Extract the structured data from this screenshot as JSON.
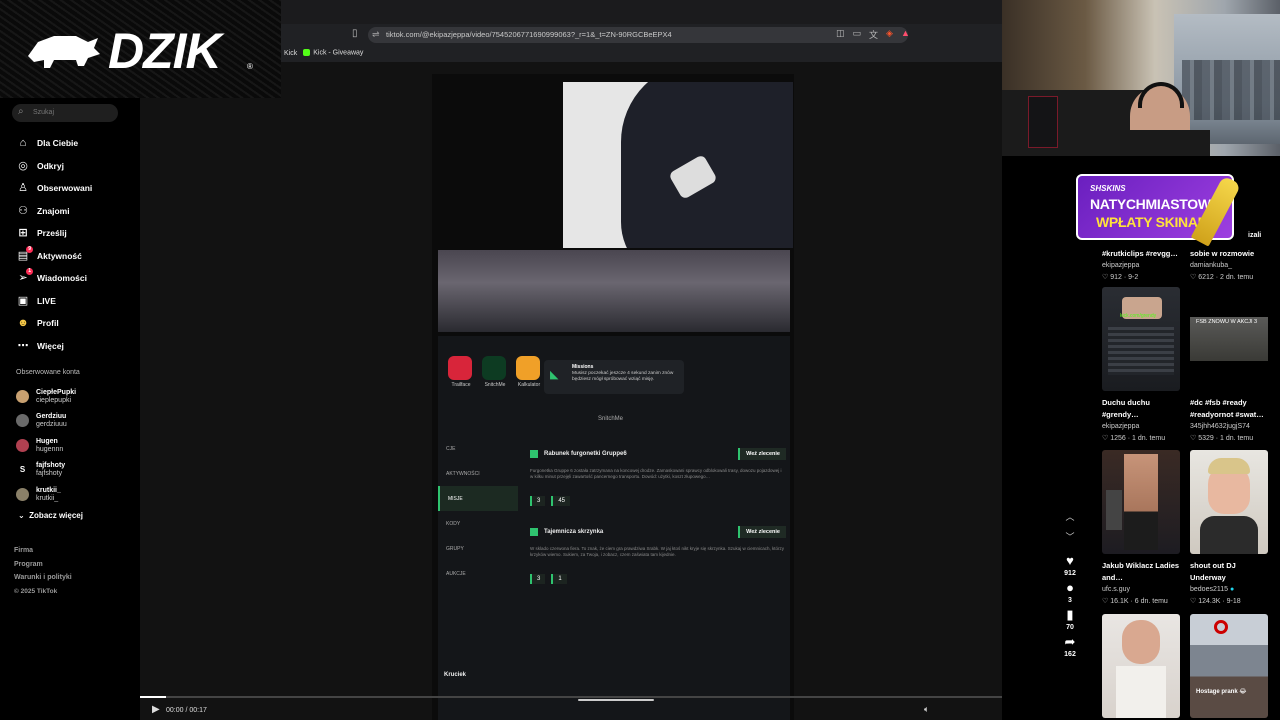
{
  "browser": {
    "url": "tiktok.com/@ekipazjeppa/video/7545206771690999063?_r=1&_t=ZN-90RGCBeEPX4",
    "bookmarks": [
      "Kick",
      "Kick - Giveaway"
    ]
  },
  "logo": {
    "text": "DZIK",
    "reg": "®"
  },
  "sidebar": {
    "search_placeholder": "Szukaj",
    "nav": [
      {
        "label": "Dla Ciebie",
        "icon": "home-icon"
      },
      {
        "label": "Odkryj",
        "icon": "compass-icon"
      },
      {
        "label": "Obserwowani",
        "icon": "following-icon"
      },
      {
        "label": "Znajomi",
        "icon": "friends-icon"
      },
      {
        "label": "Prześlij",
        "icon": "upload-icon"
      },
      {
        "label": "Aktywność",
        "icon": "activity-icon",
        "badge": "9"
      },
      {
        "label": "Wiadomości",
        "icon": "messages-icon",
        "badge": "1"
      },
      {
        "label": "LIVE",
        "icon": "live-icon"
      },
      {
        "label": "Profil",
        "icon": "profile-icon"
      },
      {
        "label": "Więcej",
        "icon": "more-icon"
      }
    ],
    "followed_title": "Obserwowane konta",
    "accounts": [
      {
        "name": "CiepłePupki",
        "handle": "cieplepupki"
      },
      {
        "name": "Gerdziuu",
        "handle": "gerdziuuu"
      },
      {
        "name": "Hugen",
        "handle": "hugennn"
      },
      {
        "name": "fajfshoty",
        "handle": "fajfshoty",
        "initial": "S"
      },
      {
        "name": "krutkii_",
        "handle": "krutkii_"
      }
    ],
    "see_more": "Zobacz więcej",
    "footer": [
      "Firma",
      "Program",
      "Warunki i polityki",
      "© 2025 TikTok"
    ]
  },
  "video": {
    "time": "00:00 / 00:17",
    "progress": 0.03,
    "phone": {
      "apps": [
        "Trailface",
        "SnitchMe",
        "Kalkulator"
      ],
      "toast_title": "Missions",
      "toast_body": "Musisz poczekać jeszcze 4 sekund zanim znów będziesz mógł spróbować wziąć misję.",
      "app_title": "SnitchMe",
      "menu": [
        "CJE",
        "AKTYWNOŚCI",
        "MISJE",
        "KODY",
        "GRUPY",
        "AUKCJE"
      ],
      "missions": [
        {
          "title": "Rabunek furgonetki Gruppe6",
          "button": "Weź zlecenie",
          "desc": "Furgonetka Gruppe 6 została zatrzymana na koncowej drodze. Zamaskowani sprawcy odblokowali trasy, dowozu pojazdowej i w kilku minut przejęli zawartość pancernego transportu. Dowód: użytki, koszt złupowego…",
          "stat1": "3",
          "stat2": "45"
        },
        {
          "title": "Tajemnicza skrzynka",
          "button": "Weź zlecenie",
          "desc": "W sklado czerwona fiera. To znak, że ciem gra prawdziwa Srabk. W jaj ktoś nikt kryje się skrzynka. Szukaj w ciemnicach, którzy krzyków wiemo. Sukiem, za Twoja, i zobacz, czem zaświata tam kijednie.",
          "stat1": "3",
          "stat2": "1"
        }
      ],
      "footer_label": "Kruciek"
    }
  },
  "actions": {
    "likes": "912",
    "comments": "3",
    "saves": "70",
    "shares": "162"
  },
  "ad": {
    "brand": "SHSKINS",
    "line1": "NATYCHMIASTOWE",
    "line2": "WPŁATY SKINAMI!"
  },
  "above_label": "izali",
  "grid": [
    {
      "title": "#krutkiclips #revgg…",
      "author": "ekipazjeppa",
      "stats": "♡ 912 · 9-2"
    },
    {
      "title": "sobie w rozmowie",
      "author": "damiankuba_",
      "stats": "♡ 6212 · 2 dn. temu"
    },
    {
      "title": "Duchu duchu #grendy…",
      "author": "ekipazjeppa",
      "stats": "♡ 1256 · 1 dn. temu",
      "thumb_text": "kick.com/grendy"
    },
    {
      "title": "#dc #fsb #ready #readyornot #swat…",
      "author": "345jhh4632jugjS74",
      "stats": "♡ 5329 · 1 dn. temu",
      "thumb_text": "FSB ZNOWU W AKCJI 3"
    },
    {
      "title": "Jakub Wiklacz Ladies and…",
      "author": "ufc.s.guy",
      "stats": "♡ 16.1K · 6 dn. temu"
    },
    {
      "title": "shout out DJ Underway",
      "author": "bedoes2115",
      "stats": "♡ 124.3K · 9-18"
    },
    {
      "title": "",
      "author": "",
      "stats": ""
    },
    {
      "title": "",
      "author": "",
      "stats": "",
      "thumb_text": "Hostage prank 😂"
    }
  ]
}
